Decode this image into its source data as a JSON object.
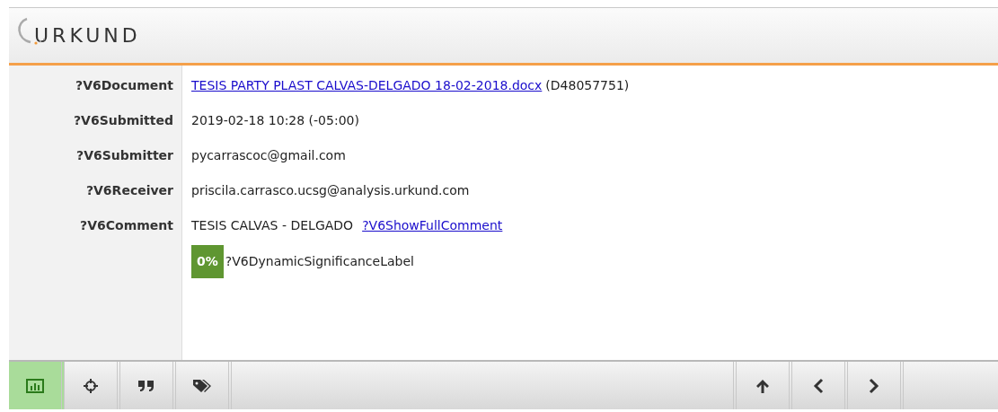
{
  "header": {
    "logo_text": "URKUND"
  },
  "fields": [
    {
      "label": "?V6Document",
      "kind": "document",
      "link": "TESIS PARTY PLAST CALVAS-DELGADO 18-02-2018.docx",
      "value": "(D48057751)"
    },
    {
      "label": "?V6Submitted",
      "kind": "text",
      "value": "2019-02-18 10:28 (-05:00)"
    },
    {
      "label": "?V6Submitter",
      "kind": "text",
      "value": "pycarrascoc@gmail.com"
    },
    {
      "label": "?V6Receiver",
      "kind": "text",
      "value": "priscila.carrasco.ucsg@analysis.urkund.com"
    },
    {
      "label": "?V6Comment",
      "kind": "comment",
      "value": "TESIS CALVAS - DELGADO",
      "link": "?V6ShowFullComment"
    }
  ],
  "significance": {
    "badge": "0%",
    "label": "?V6DynamicSignificanceLabel"
  },
  "toolbar": {
    "left": [
      {
        "kind": "chart",
        "selected": true
      },
      {
        "kind": "crosshair",
        "selected": false
      },
      {
        "kind": "quote",
        "selected": false
      },
      {
        "kind": "tags",
        "selected": false
      }
    ],
    "right": [
      {
        "kind": "up",
        "selected": false
      },
      {
        "kind": "left",
        "selected": false
      },
      {
        "kind": "right",
        "selected": false
      }
    ]
  }
}
